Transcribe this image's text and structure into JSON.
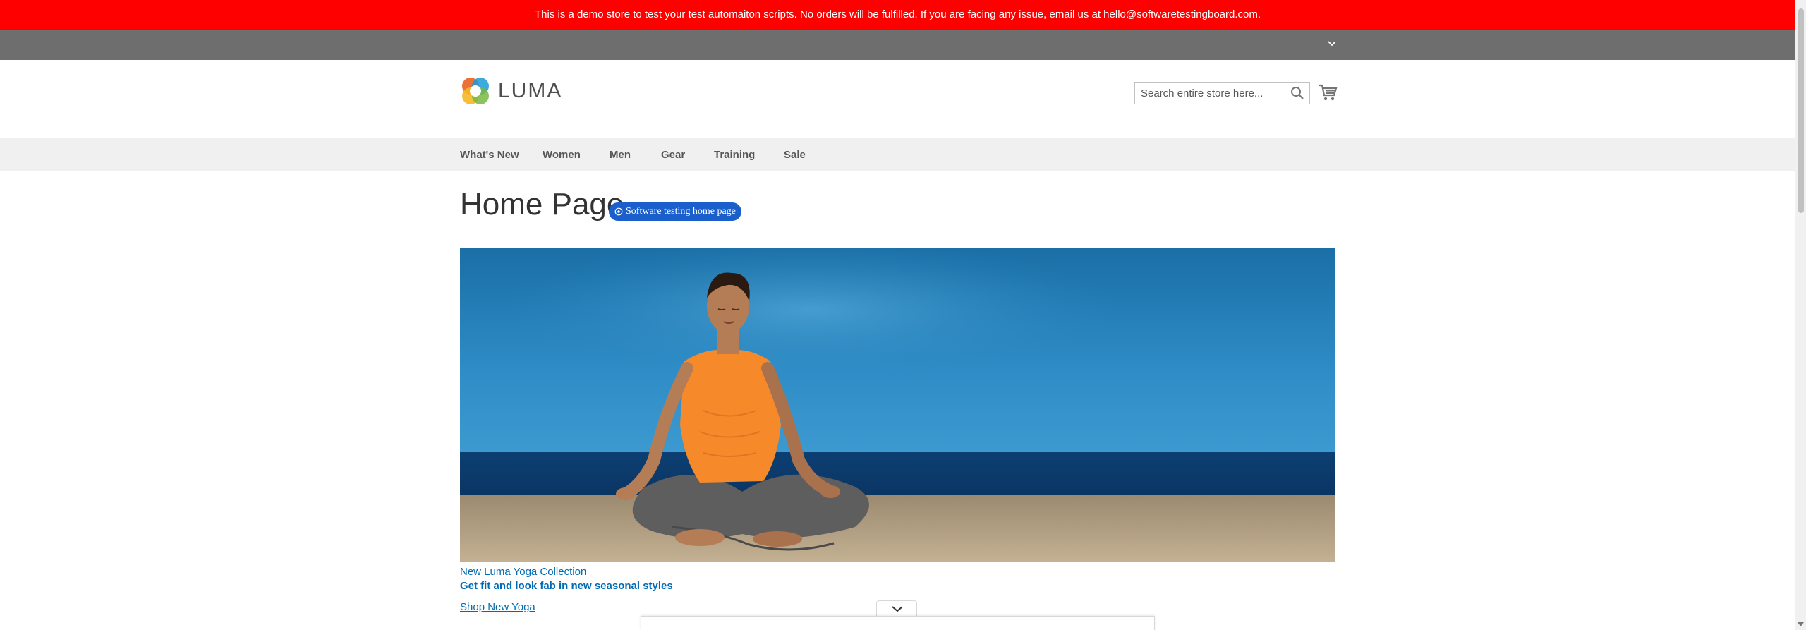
{
  "demo_notice": "This is a demo store to test your test automaiton scripts. No orders will be fulfilled. If you are facing any issue, email us at hello@softwaretestingboard.com.",
  "logo": {
    "text": "LUMA"
  },
  "search": {
    "placeholder": "Search entire store here..."
  },
  "nav": {
    "items": [
      {
        "label": "What's New"
      },
      {
        "label": "Women"
      },
      {
        "label": "Men"
      },
      {
        "label": "Gear"
      },
      {
        "label": "Training"
      },
      {
        "label": "Sale"
      }
    ]
  },
  "page": {
    "title": "Home Page",
    "badge": "Software testing home page"
  },
  "hero": {
    "collection_link": "New Luma Yoga Collection",
    "tagline_link": "Get fit and look fab in new seasonal styles",
    "shop_link": "Shop New Yoga"
  },
  "colors": {
    "banner": "#ff0000",
    "link": "#006bb4",
    "badge": "#1a5fcc"
  }
}
